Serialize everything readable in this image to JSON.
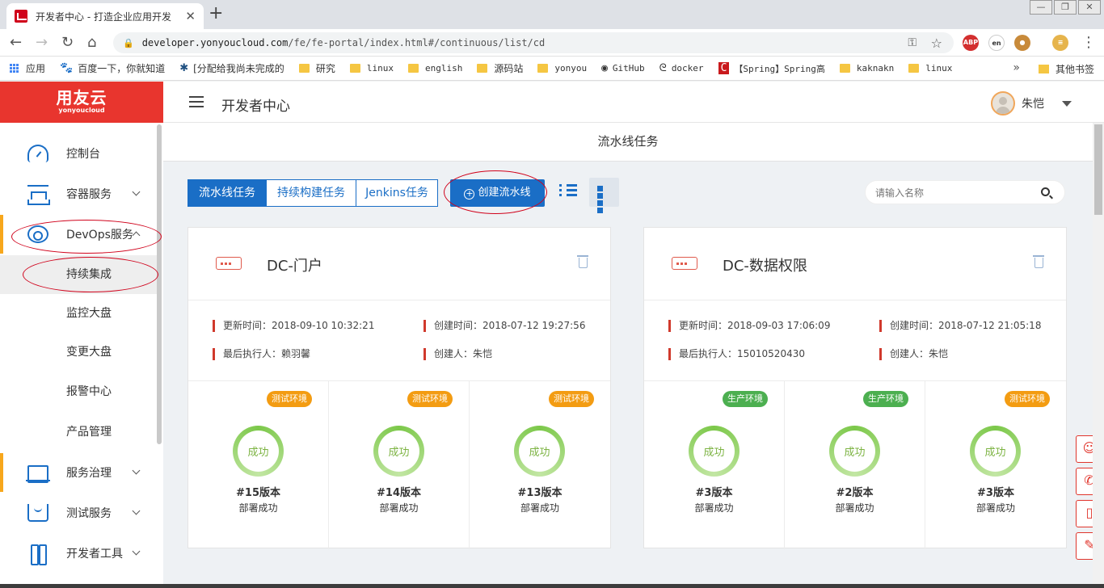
{
  "browser": {
    "tab_title": "开发者中心 - 打造企业应用开发",
    "url_host": "developer.yonyoucloud.com",
    "url_path": "/fe/fe-portal/index.html#/continuous/list/cd",
    "extensions": [
      "ABP",
      "en",
      "cookie",
      "burger"
    ]
  },
  "bookmarks": [
    {
      "label": "应用",
      "icon": "apps-icon"
    },
    {
      "label": "百度一下，你就知道",
      "icon": "baidu-icon"
    },
    {
      "label": "[分配给我尚未完成的",
      "icon": "jira-icon"
    },
    {
      "label": "研究",
      "icon": "folder-icon"
    },
    {
      "label": "linux",
      "icon": "folder-icon"
    },
    {
      "label": "english",
      "icon": "folder-icon"
    },
    {
      "label": "源码站",
      "icon": "folder-icon"
    },
    {
      "label": "yonyou",
      "icon": "folder-icon"
    },
    {
      "label": "GitHub",
      "icon": "github-icon"
    },
    {
      "label": "docker",
      "icon": "docker-icon"
    },
    {
      "label": "【Spring】Spring高",
      "icon": "csdn-icon"
    },
    {
      "label": "kaknakn",
      "icon": "folder-icon"
    },
    {
      "label": "linux",
      "icon": "folder-icon"
    }
  ],
  "bookmarks_other": "其他书签",
  "app": {
    "logo_cn": "用友云",
    "logo_en": "yonyoucloud",
    "header_title": "开发者中心",
    "user_name": "朱恺"
  },
  "sidebar": {
    "items": [
      {
        "label": "控制台"
      },
      {
        "label": "容器服务"
      },
      {
        "label": "DevOps服务"
      },
      {
        "label": "持续集成"
      },
      {
        "label": "监控大盘"
      },
      {
        "label": "变更大盘"
      },
      {
        "label": "报警中心"
      },
      {
        "label": "产品管理"
      },
      {
        "label": "服务治理"
      },
      {
        "label": "测试服务"
      },
      {
        "label": "开发者工具"
      }
    ]
  },
  "page": {
    "title": "流水线任务",
    "tabs": [
      "流水线任务",
      "持续构建任务",
      "Jenkins任务"
    ],
    "create_button": "创建流水线",
    "search_placeholder": "请输入名称"
  },
  "cards": [
    {
      "name": "DC-门户",
      "updated": "更新时间：2018-09-10 10:32:21",
      "created": "创建时间：2018-07-12 19:27:56",
      "last_executor": "最后执行人：赖羽馨",
      "creator": "创建人：朱恺",
      "builds": [
        {
          "env": "测试环境",
          "env_type": "test",
          "status": "成功",
          "version": "#15版本",
          "deploy": "部署成功"
        },
        {
          "env": "测试环境",
          "env_type": "test",
          "status": "成功",
          "version": "#14版本",
          "deploy": "部署成功"
        },
        {
          "env": "测试环境",
          "env_type": "test",
          "status": "成功",
          "version": "#13版本",
          "deploy": "部署成功"
        }
      ]
    },
    {
      "name": "DC-数据权限",
      "updated": "更新时间：2018-09-03 17:06:09",
      "created": "创建时间：2018-07-12 21:05:18",
      "last_executor": "最后执行人：15010520430",
      "creator": "创建人：朱恺",
      "builds": [
        {
          "env": "生产环境",
          "env_type": "prod",
          "status": "成功",
          "version": "#3版本",
          "deploy": "部署成功"
        },
        {
          "env": "生产环境",
          "env_type": "prod",
          "status": "成功",
          "version": "#2版本",
          "deploy": "部署成功"
        },
        {
          "env": "测试环境",
          "env_type": "test",
          "status": "成功",
          "version": "#3版本",
          "deploy": "部署成功"
        }
      ]
    }
  ],
  "floating_tools": [
    "robot-icon",
    "phone-icon",
    "mobile-icon",
    "feedback-icon"
  ],
  "colors": {
    "brand_red": "#e8352e",
    "primary_blue": "#1a6ec6",
    "test_env": "#f39c12",
    "prod_env": "#4caf50",
    "success_green": "#7cc84a"
  }
}
